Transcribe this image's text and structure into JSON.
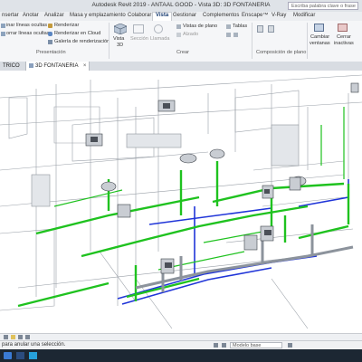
{
  "window": {
    "title": "Autodesk Revit 2019 - ANTAAL GOOD - Vista 3D: 3D FONTANERIA",
    "search_placeholder": "Escriba palabra clave o frase"
  },
  "ribbon_tabs": [
    {
      "label": "nsertar"
    },
    {
      "label": "Anotar"
    },
    {
      "label": "Analizar"
    },
    {
      "label": "Masa y emplazamiento"
    },
    {
      "label": "Colaborar"
    },
    {
      "label": "Vista",
      "active": true
    },
    {
      "label": "Gestionar"
    },
    {
      "label": "Complementos"
    },
    {
      "label": "Enscape™"
    },
    {
      "label": "V-Ray"
    },
    {
      "label": "Modificar"
    }
  ],
  "ribbon": {
    "presentacion_items": [
      "inar líneas ocultas",
      "orrar líneas ocultas",
      "Galería de renderización"
    ],
    "render_items": [
      "Renderizar",
      "Renderizar en Cloud"
    ],
    "panel_presentacion": "Presentación",
    "crear_buttons": {
      "vista3d_line1": "Vista",
      "vista3d_line2": "3D",
      "seccion": "Sección",
      "llamada": "Llamada",
      "alzado": "Alzado",
      "vistas_plano": "Vistas de plano",
      "tablas": "Tablas"
    },
    "panel_crear": "Crear",
    "panel_composicion": "Composición de plano",
    "ventanas": {
      "cambiar_line1": "Cambiar",
      "cambiar_line2": "ventanas",
      "cerrar_line1": "Cerrar",
      "cerrar_line2": "inactivas"
    }
  },
  "view_tabs": [
    {
      "label": "TRICO",
      "active": false
    },
    {
      "label": "3D FONTANERIA",
      "active": true
    }
  ],
  "viewbar": {
    "scale_hint": "1 : 100"
  },
  "status": {
    "message": "para anular una selección.",
    "model": "Modelo base"
  },
  "colors": {
    "green_pipe": "#1fc21f",
    "blue_pipe": "#2035d8",
    "gray_pipe": "#9aa0a8",
    "titlebar": "#dfe3e8",
    "taskbar": "#1c2733"
  }
}
